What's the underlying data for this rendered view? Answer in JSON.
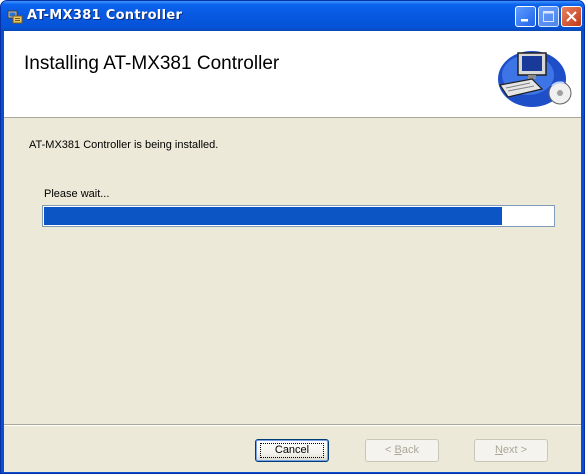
{
  "window": {
    "title": "AT-MX381 Controller"
  },
  "banner": {
    "heading": "Installing AT-MX381 Controller",
    "graphic": "computer-setup-icon"
  },
  "body": {
    "status_text": "AT-MX381 Controller is being installed.",
    "wait_label": "Please wait...",
    "progress_fraction": 0.9
  },
  "buttons": {
    "cancel": "Cancel",
    "back_accel": "B",
    "back_rest": "ack",
    "back_prefix": "< ",
    "next_accel": "N",
    "next_rest": "ext >"
  },
  "colors": {
    "titlebar": "#0a63ee",
    "dialog_bg": "#ece9d8",
    "progress_fill": "#0b55c4"
  }
}
